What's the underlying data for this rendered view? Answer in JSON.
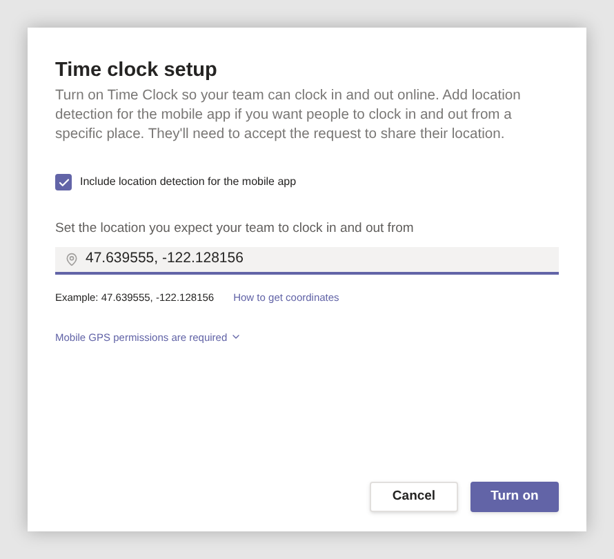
{
  "dialog": {
    "title": "Time clock setup",
    "description": "Turn on Time Clock so your team can clock in and out online. Add location detection for the mobile app if you want people to clock in and out from a specific place. They'll need to accept the request to share their location.",
    "checkbox": {
      "label": "Include location detection for the mobile app",
      "checked": true
    },
    "location_label": "Set the location you expect your team to clock in and out from",
    "location_field": {
      "value": "47.639555, -122.128156"
    },
    "example": "Example: 47.639555, -122.128156",
    "help_link": "How to get coordinates",
    "permissions_toggle": {
      "label": "Mobile GPS permissions are required",
      "expanded": false
    },
    "buttons": [
      {
        "label": "Cancel",
        "kind": "secondary"
      },
      {
        "label": "Turn on",
        "kind": "primary"
      }
    ]
  }
}
